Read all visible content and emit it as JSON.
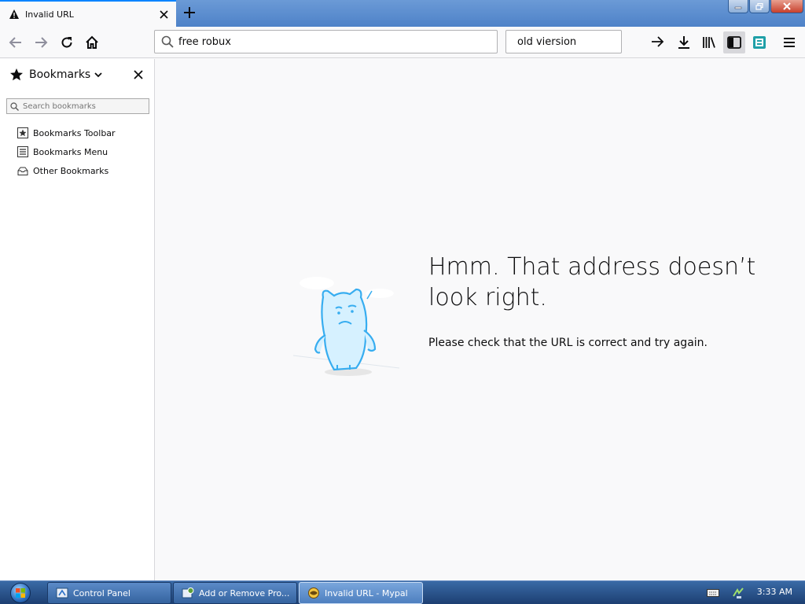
{
  "tab": {
    "title": "Invalid URL",
    "active_border_color": "#0a84ff"
  },
  "urlbar": {
    "value": "free robux"
  },
  "searchbar": {
    "value": "old viersion"
  },
  "sidebar": {
    "title": "Bookmarks",
    "search_placeholder": "Search bookmarks",
    "items": [
      {
        "label": "Bookmarks Toolbar",
        "icon": "bookmarks-toolbar-icon"
      },
      {
        "label": "Bookmarks Menu",
        "icon": "bookmarks-menu-icon"
      },
      {
        "label": "Other Bookmarks",
        "icon": "other-bookmarks-icon"
      }
    ]
  },
  "error": {
    "title": "Hmm. That address doesn’t look right.",
    "description": "Please check that the URL is correct and try again."
  },
  "taskbar": {
    "tasks": [
      {
        "label": "Control Panel",
        "active": false
      },
      {
        "label": "Add or Remove Pro...",
        "active": false
      },
      {
        "label": "Invalid URL - Mypal",
        "active": true
      }
    ],
    "clock": "3:33 AM"
  }
}
